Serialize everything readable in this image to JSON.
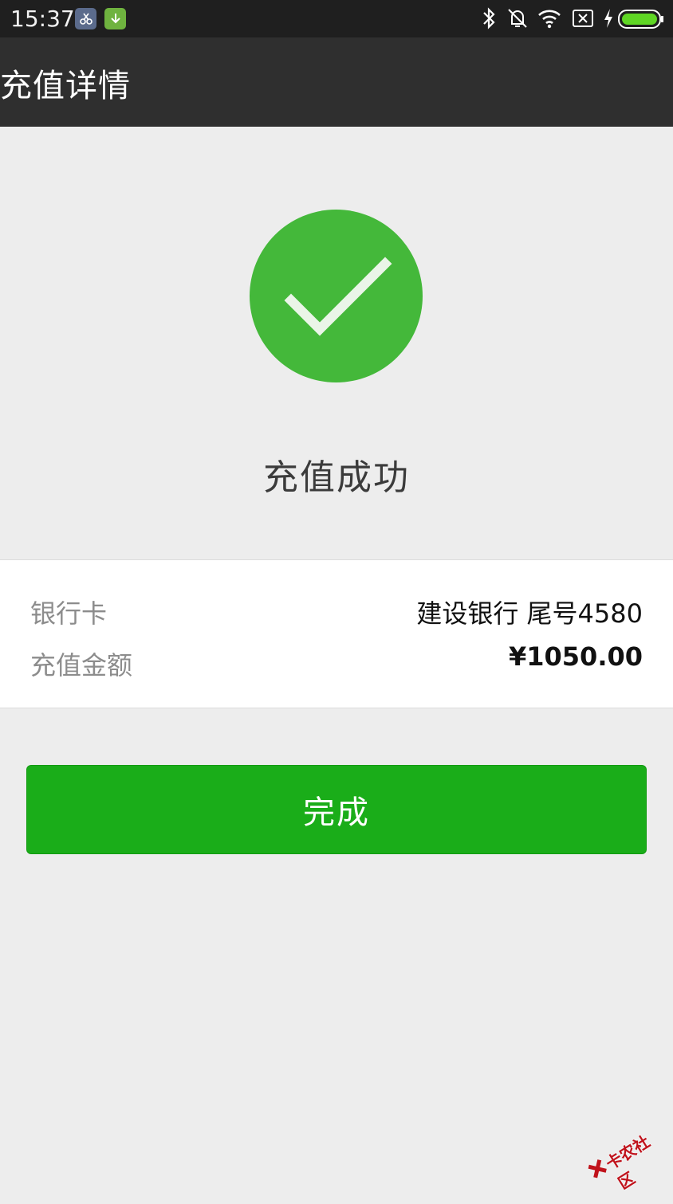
{
  "status_bar": {
    "time": "15:37",
    "icons": [
      "scissors-app-icon",
      "download-app-icon",
      "bluetooth-icon",
      "vibrate-off-icon",
      "wifi-icon",
      "no-sim-icon",
      "charging-icon",
      "battery-icon"
    ]
  },
  "header": {
    "title": "充值详情"
  },
  "result": {
    "icon": "success-check-icon",
    "status_text": "充值成功",
    "accent_color": "#44b83a"
  },
  "details": {
    "bank_card": {
      "label": "银行卡",
      "value": "建设银行 尾号4580"
    },
    "amount": {
      "label": "充值金额",
      "value": "¥1050.00"
    }
  },
  "actions": {
    "done_label": "完成",
    "button_color": "#1aad19"
  },
  "watermark": {
    "text": "卡农社区"
  }
}
